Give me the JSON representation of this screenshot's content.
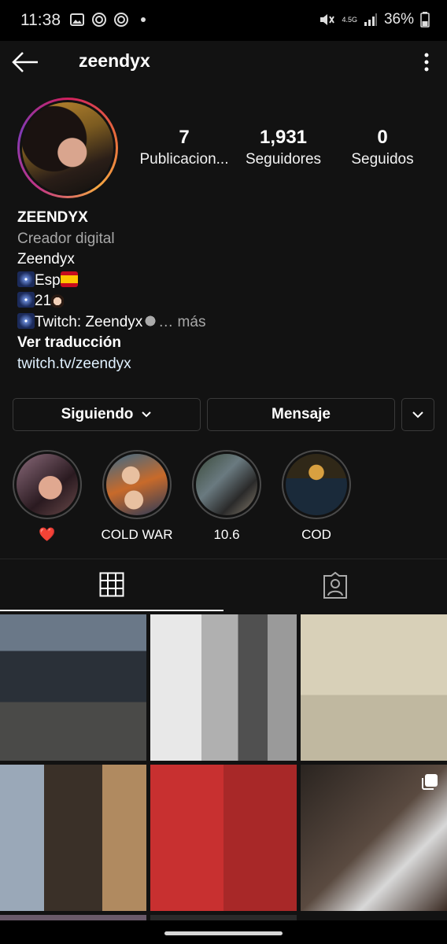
{
  "status_bar": {
    "time": "11:38",
    "network": "4.5G",
    "battery": "36%",
    "icons": [
      "image-icon",
      "app-notification-icon",
      "app-notification-icon",
      "dot-icon",
      "mute-icon",
      "signal-icon",
      "battery-icon"
    ]
  },
  "header": {
    "username": "zeendyx"
  },
  "stats": {
    "posts": {
      "value": "7",
      "label": "Publicacion..."
    },
    "followers": {
      "value": "1,931",
      "label": "Seguidores"
    },
    "following": {
      "value": "0",
      "label": "Seguidos"
    }
  },
  "bio": {
    "name": "ZEENDYX",
    "category": "Creador digital",
    "line1": "Zeendyx",
    "line2": "Esp",
    "line3": "21",
    "line4": "Twitch: Zeendyx",
    "more": "… más",
    "translate": "Ver traducción",
    "link": "twitch.tv/zeendyx"
  },
  "actions": {
    "following_label": "Siguiendo",
    "message_label": "Mensaje"
  },
  "highlights": [
    {
      "label": "❤️"
    },
    {
      "label": "COLD WAR"
    },
    {
      "label": "10.6"
    },
    {
      "label": "COD"
    }
  ],
  "colors": {
    "background": "#121212",
    "story_ring": "#d1205e",
    "link": "#e0f1ff",
    "secondary_text": "#a8a8a8"
  }
}
